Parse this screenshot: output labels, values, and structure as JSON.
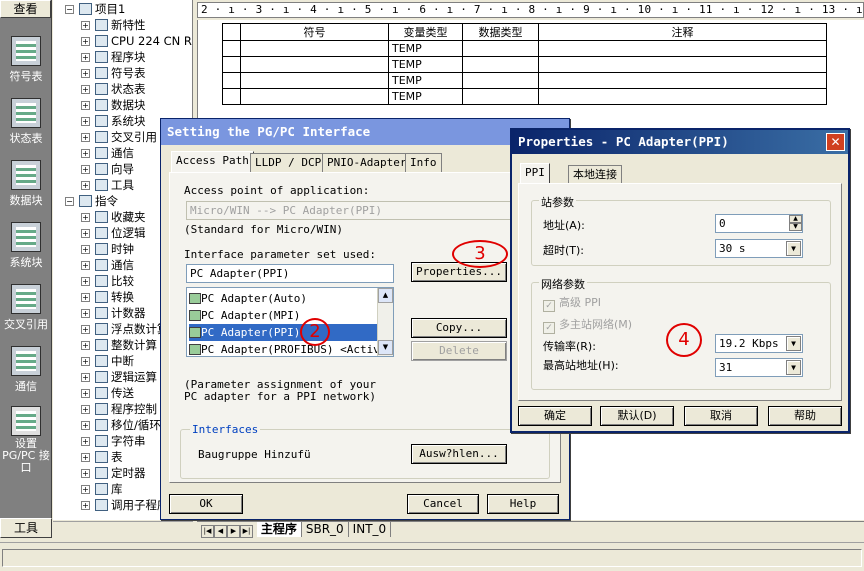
{
  "nav": {
    "title": "查看",
    "items": [
      "符号表",
      "状态表",
      "数据块",
      "系统块",
      "交叉引用",
      "通信",
      "设置 PG/PC 接口"
    ],
    "footer": "工具"
  },
  "tree": {
    "project": "项目1",
    "nodes": [
      "新特性",
      "CPU 224 CN R",
      "程序块",
      "符号表",
      "状态表",
      "数据块",
      "系统块",
      "交叉引用",
      "通信",
      "向导",
      "工具"
    ],
    "instructions": "指令",
    "inst_nodes": [
      "收藏夹",
      "位逻辑",
      "时钟",
      "通信",
      "比较",
      "转换",
      "计数器",
      "浮点数计算",
      "整数计算",
      "中断",
      "逻辑运算",
      "传送",
      "程序控制",
      "移位/循环",
      "字符串",
      "表",
      "定时器",
      "库",
      "调用子程序"
    ]
  },
  "editor": {
    "ruler": "2 · ı · 3 · ı · 4 · ı · 5 · ı · 6 · ı · 7 · ı · 8 · ı · 9 · ı · 10 · ı · 11 · ı · 12 · ı · 13 · ı · 14 · ı · 15 · ı · 16 · ı · 17 · ı · 18 · ı · 19 ·",
    "headers": [
      "符号",
      "变量类型",
      "数据类型",
      "注释"
    ],
    "var_type": "TEMP",
    "tabs": [
      "主程序",
      "SBR_0",
      "INT_0"
    ]
  },
  "pgpc": {
    "title": "Setting the PG/PC Interface",
    "tabs": [
      "Access Path",
      "LLDP / DCP",
      "PNIO-Adapter",
      "Info"
    ],
    "access_point_label": "Access point of application:",
    "access_point_value": "Micro/WIN        --> PC Adapter(PPI)",
    "standard_text": "(Standard for Micro/WIN)",
    "param_set_label": "Interface parameter set used:",
    "param_set_value": "PC Adapter(PPI)",
    "properties_button": "Properties...",
    "list_items": [
      "PC Adapter(Auto)",
      "PC Adapter(MPI)",
      "PC Adapter(PPI)",
      "PC Adapter(PROFIBUS)  <Activ"
    ],
    "copy_button": "Copy...",
    "delete_button": "Delete",
    "param_note": "(Parameter assignment of your PC adapter for a PPI network)",
    "interfaces_label": "Interfaces",
    "add_remove_label": "Baugruppe Hinzufü",
    "select_button": "Ausw?hlen...",
    "ok_button": "OK",
    "cancel_button": "Cancel",
    "help_button": "Help"
  },
  "props": {
    "title": "Properties - PC Adapter(PPI)",
    "tabs": [
      "PPI",
      "本地连接"
    ],
    "station_group": "站参数",
    "address_label": "地址(A):",
    "address_value": "0",
    "timeout_label": "超时(T):",
    "timeout_value": "30 s",
    "network_group": "网络参数",
    "advanced_ppi": "高级 PPI",
    "multi_master": "多主站网络(M)",
    "baud_label": "传输率(R):",
    "baud_value": "19.2 Kbps",
    "highest_label": "最高站地址(H):",
    "highest_value": "31",
    "ok_button": "确定",
    "default_button": "默认(D)",
    "cancel_button": "取消",
    "help_button": "帮助"
  },
  "markers": [
    "2",
    "3",
    "4"
  ],
  "colors": {
    "title_active": "#0a246a",
    "title_inactive": "#7a96df",
    "marker": "#e00000"
  }
}
